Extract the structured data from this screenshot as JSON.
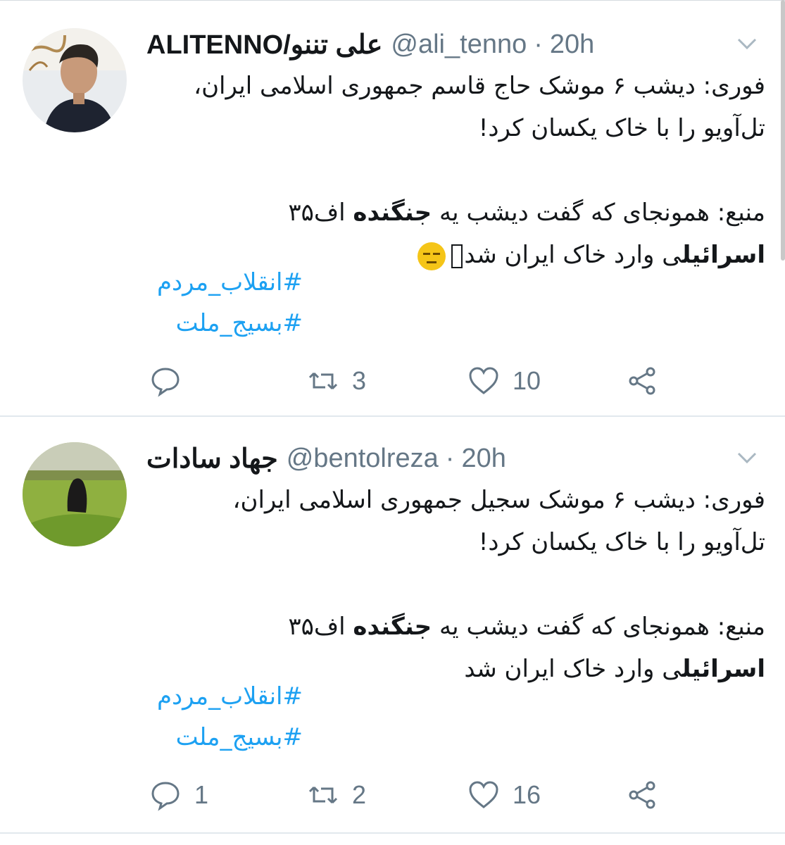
{
  "tweets": [
    {
      "name": "ALITENNO/علی تننو",
      "handle": "@ali_tenno",
      "separator": "·",
      "time": "20h",
      "line1": "فوری: دیشب ۶ موشک حاج قاسم جمهوری اسلامی ایران،",
      "line2": "تل‌آویو را با خاک یکسان کرد!",
      "line3_pre": "منبع: همونجای که گفت دیشب یه ",
      "line3_bold": "جنگنده",
      "line3_post": " اف۳۵",
      "line4_bold": "اسرائیل",
      "line4_post": "ی وارد خاک ایران شد",
      "emoji": "expressionless-face",
      "hashtags": [
        "#انقلاب_مردم",
        "#بسیج_ملت"
      ],
      "actions": {
        "reply_count": "",
        "retweet_count": "3",
        "like_count": "10"
      }
    },
    {
      "name": "جهاد سادات",
      "handle": "@bentolreza",
      "separator": "·",
      "time": "20h",
      "line1": "فوری: دیشب ۶ موشک سجیل جمهوری اسلامی ایران،",
      "line2": "تل‌آویو را با خاک یکسان کرد!",
      "line3_pre": "منبع: همونجای که گفت دیشب یه ",
      "line3_bold": "جنگنده",
      "line3_post": " اف۳۵",
      "line4_bold": "اسرائیل",
      "line4_post": "ی وارد خاک ایران شد",
      "hashtags": [
        "#انقلاب_مردم",
        "#بسیج_ملت"
      ],
      "actions": {
        "reply_count": "1",
        "retweet_count": "2",
        "like_count": "16"
      }
    }
  ],
  "icons": {
    "reply": "reply-icon",
    "retweet": "retweet-icon",
    "like": "heart-icon",
    "share": "share-icon",
    "menu": "chevron-down-icon"
  },
  "colors": {
    "text": "#14171a",
    "secondary": "#657786",
    "hashtag": "#1da1f2",
    "divider": "#e1e8ed"
  }
}
